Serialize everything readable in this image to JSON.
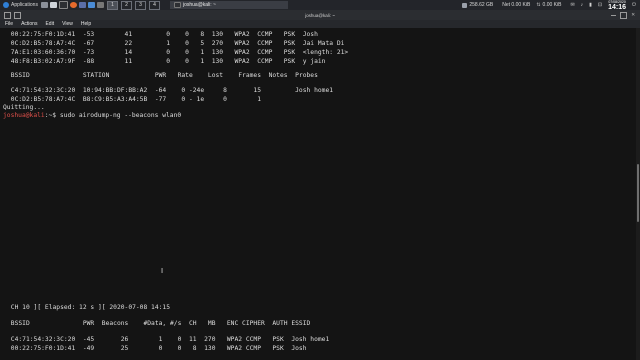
{
  "panel": {
    "applications_label": "Applications",
    "workspaces": [
      "1",
      "2",
      "3",
      "4"
    ],
    "active_workspace": "1",
    "task_title": "joshua@kali: ~",
    "disk": "258.62 GB",
    "net_label": "Net 0.00 KiB",
    "net_out": "0.00 KiB",
    "clock_date": "07/08/2020",
    "clock_time": "14:16"
  },
  "window": {
    "title": "joshua@kali: ~"
  },
  "menu": [
    "File",
    "Actions",
    "Edit",
    "View",
    "Help"
  ],
  "terminal": {
    "top_lines": [
      " 00:22:75:F0:1D:41  -53        41         0    0   8  130   WPA2  CCMP   PSK  Josh",
      " 0C:D2:B5:78:A7:4C  -67        22         1    0   5  270   WPA2  CCMP   PSK  Jai Mata Di",
      " 7A:E1:03:60:36:70  -73        14         0    0   1  130   WPA2  CCMP   PSK  <length: 21>",
      " 48:F8:B3:02:A7:9F  -88        11         0    0   1  130   WPA2  CCMP   PSK  y jain",
      "",
      " BSSID              STATION            PWR   Rate    Lost    Frames  Notes  Probes",
      "",
      " C4:71:54:32:3C:20  10:94:BB:DF:BB:A2  -64    0 -24e     8       15         Josh home1",
      " 0C:D2:B5:78:A7:4C  B8:C9:B5:A3:A4:5B  -77    0 - 1e     0        1",
      "Quitting..."
    ],
    "prompt_user": "joshua@kali",
    "prompt_rest": ":~$ sudo airodump-ng --beacons wlan0",
    "bottom_lines": [
      " CH 10 ][ Elapsed: 12 s ][ 2020-07-08 14:15",
      "",
      " BSSID              PWR  Beacons    #Data, #/s  CH   MB   ENC CIPHER  AUTH ESSID",
      "",
      " C4:71:54:32:3C:20  -45       26        1    0  11  270   WPA2 CCMP   PSK  Josh home1",
      " 00:22:75:F0:1D:41  -49       25        0    0   8  130   WPA2 CCMP   PSK  Josh"
    ]
  },
  "cursor_glyph": "I"
}
